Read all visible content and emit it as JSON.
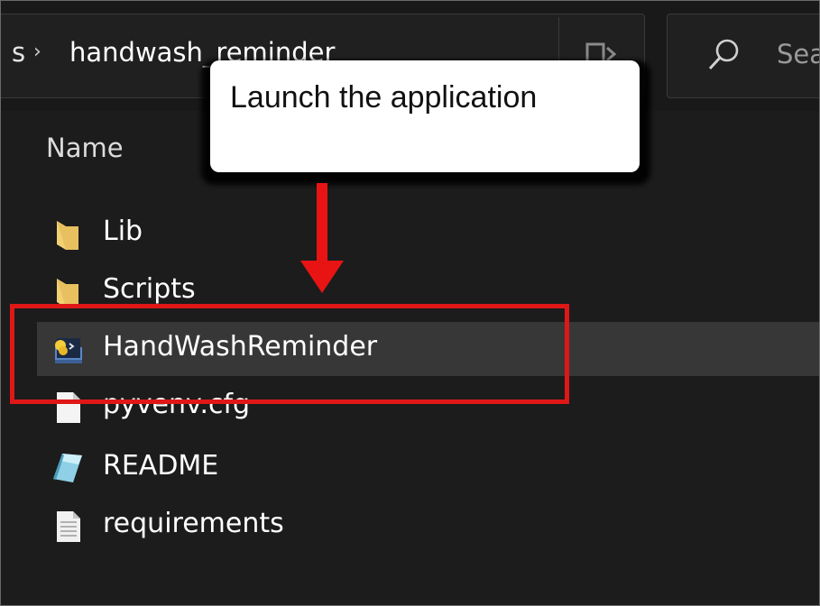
{
  "window": {
    "breadcrumb_prev": "s",
    "breadcrumb_separator": "›",
    "breadcrumb_current": "handwash_reminder",
    "search_placeholder": "Search"
  },
  "file_list": {
    "column_header": "Name",
    "items": [
      {
        "label": "Lib",
        "icon": "folder-icon"
      },
      {
        "label": "Scripts",
        "icon": "folder-icon"
      },
      {
        "label": "HandWashReminder",
        "icon": "python-executable-icon",
        "selected": true
      },
      {
        "label": "pyvenv.cfg",
        "icon": "document-icon"
      },
      {
        "label": "README",
        "icon": "readme-icon"
      },
      {
        "label": "requirements",
        "icon": "text-file-icon"
      }
    ]
  },
  "annotation": {
    "callout_text": "Launch the application",
    "highlight_color": "#e01717"
  },
  "colors": {
    "background": "#1c1c1c",
    "selected_row": "#373737",
    "folder": "#f3d173"
  }
}
